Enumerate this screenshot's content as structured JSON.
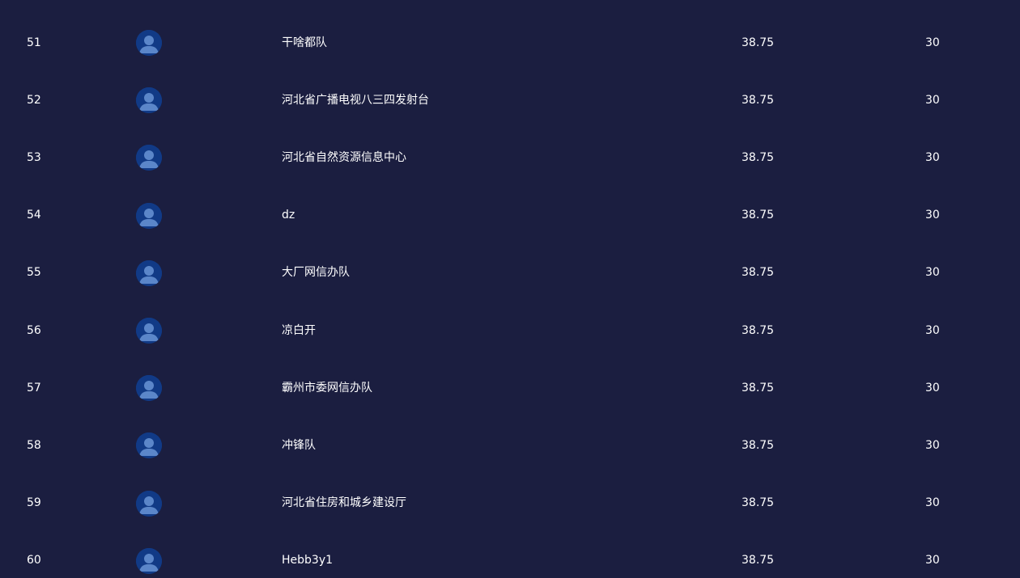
{
  "leaderboard": {
    "rows": [
      {
        "rank": "51",
        "name": "干啥都队",
        "score": "38.75",
        "count": "30",
        "avatar": "user-avatar-icon"
      },
      {
        "rank": "52",
        "name": "河北省广播电视八三四发射台",
        "score": "38.75",
        "count": "30",
        "avatar": "user-avatar-icon"
      },
      {
        "rank": "53",
        "name": "河北省自然资源信息中心",
        "score": "38.75",
        "count": "30",
        "avatar": "user-avatar-icon"
      },
      {
        "rank": "54",
        "name": "dz",
        "score": "38.75",
        "count": "30",
        "avatar": "user-avatar-icon"
      },
      {
        "rank": "55",
        "name": "大厂网信办队",
        "score": "38.75",
        "count": "30",
        "avatar": "user-avatar-icon"
      },
      {
        "rank": "56",
        "name": "凉白开",
        "score": "38.75",
        "count": "30",
        "avatar": "user-avatar-icon"
      },
      {
        "rank": "57",
        "name": "霸州市委网信办队",
        "score": "38.75",
        "count": "30",
        "avatar": "user-avatar-icon"
      },
      {
        "rank": "58",
        "name": "冲锋队",
        "score": "38.75",
        "count": "30",
        "avatar": "user-avatar-icon"
      },
      {
        "rank": "59",
        "name": "河北省住房和城乡建设厅",
        "score": "38.75",
        "count": "30",
        "avatar": "user-avatar-icon"
      },
      {
        "rank": "60",
        "name": "Hebb3y1",
        "score": "38.75",
        "count": "30",
        "avatar": "user-avatar-icon"
      }
    ]
  },
  "colors": {
    "background": "#1b1e40",
    "text": "#ffffff",
    "avatar_bg": "#113a86",
    "avatar_figure": "#5b86c9"
  }
}
